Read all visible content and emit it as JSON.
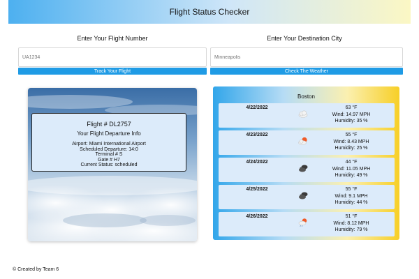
{
  "header": {
    "title": "Flight Status Checker"
  },
  "flight_search": {
    "heading": "Enter Your Flight Number",
    "placeholder": "UA1234",
    "button_label": "Track Your Flight"
  },
  "weather_search": {
    "heading": "Enter Your Destination City",
    "placeholder": "Minneapolis",
    "button_label": "Check The Weather"
  },
  "flight": {
    "number": "Flight # DL2757",
    "subtitle": "Your Flight Departure Info",
    "airport": "Airport: Miami International Airport",
    "scheduled": "Scheduled Departure: 14:0",
    "terminal": "Terminal # S",
    "gate": "Gate # H7",
    "status": "Current Status: scheduled"
  },
  "weather": {
    "city": "Boston",
    "days": [
      {
        "date": "4/22/2022",
        "temp": "63 °F",
        "wind": "Wind: 14.97 MPH",
        "humidity": "Humidity: 35 %",
        "icon": "cloud-icon"
      },
      {
        "date": "4/23/2022",
        "temp": "55 °F",
        "wind": "Wind: 8.43 MPH",
        "humidity": "Humidity: 25 %",
        "icon": "sun-behind-cloud-icon"
      },
      {
        "date": "4/24/2022",
        "temp": "44 °F",
        "wind": "Wind: 11.05 MPH",
        "humidity": "Humidity: 49 %",
        "icon": "dark-clouds-icon"
      },
      {
        "date": "4/25/2022",
        "temp": "55 °F",
        "wind": "Wind: 9.1 MPH",
        "humidity": "Humidity: 44 %",
        "icon": "dark-clouds-icon"
      },
      {
        "date": "4/26/2022",
        "temp": "51 °F",
        "wind": "Wind: 8.12 MPH",
        "humidity": "Humidity: 79 %",
        "icon": "sun-cloud-rain-icon"
      }
    ]
  },
  "footer": {
    "text": "© Created by Team 6"
  },
  "colors": {
    "button": "#1f9be5",
    "panel_box": "#dcebfa"
  }
}
